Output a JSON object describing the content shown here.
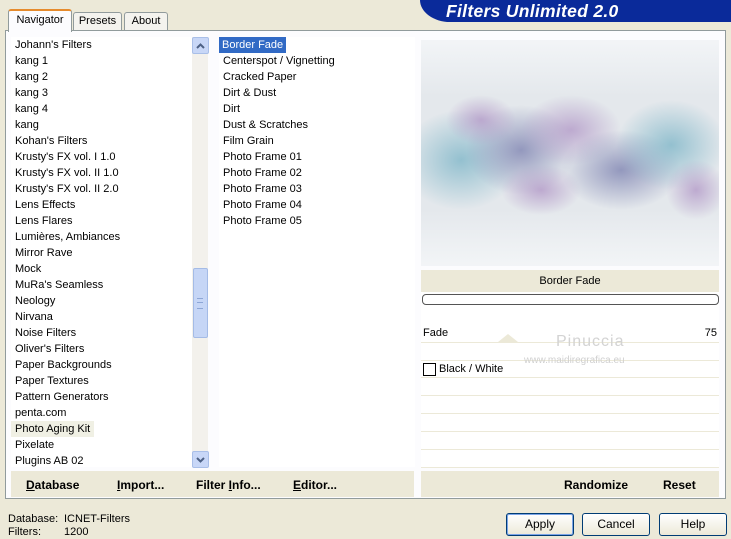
{
  "app": {
    "title": "Filters Unlimited 2.0"
  },
  "tabs": [
    {
      "label": "Navigator",
      "active": true
    },
    {
      "label": "Presets",
      "active": false
    },
    {
      "label": "About",
      "active": false
    }
  ],
  "categories": {
    "items": [
      "Johann's Filters",
      "kang 1",
      "kang 2",
      "kang 3",
      "kang 4",
      "kang",
      "Kohan's Filters",
      "Krusty's FX vol. I 1.0",
      "Krusty's FX vol. II 1.0",
      "Krusty's FX vol. II 2.0",
      "Lens Effects",
      "Lens Flares",
      "Lumières, Ambiances",
      "Mirror Rave",
      "Mock",
      "MuRa's Seamless",
      "Neology",
      "Nirvana",
      "Noise Filters",
      "Oliver's Filters",
      "Paper Backgrounds",
      "Paper Textures",
      "Pattern Generators",
      "penta.com",
      "Photo Aging Kit",
      "Pixelate",
      "Plugins AB 02"
    ],
    "selected": "Photo Aging Kit"
  },
  "filters": {
    "items": [
      "Border Fade",
      "Centerspot / Vignetting",
      "Cracked Paper",
      "Dirt & Dust",
      "Dirt",
      "Dust & Scratches",
      "Film Grain",
      "Photo Frame 01",
      "Photo Frame 02",
      "Photo Frame 03",
      "Photo Frame 04",
      "Photo Frame 05"
    ],
    "selected": "Border Fade"
  },
  "params": {
    "filter_name": "Border Fade",
    "fade_label": "Fade",
    "fade_value": "75",
    "bw_label": "Black / White",
    "bw_checked": false
  },
  "watermark": {
    "line1": "Pinuccia",
    "line2": "www.maidiregrafica.eu"
  },
  "toolbar": {
    "database": "Database",
    "import": "Import...",
    "filter_info": "Filter Info...",
    "editor": "Editor...",
    "randomize": "Randomize",
    "reset": "Reset"
  },
  "status": {
    "database_label": "Database:",
    "database_value": "ICNET-Filters",
    "filters_label": "Filters:",
    "filters_value": "1200"
  },
  "buttons": {
    "apply": "Apply",
    "cancel": "Cancel",
    "help": "Help"
  },
  "icons": {
    "scroll_up": "chevron-up-icon",
    "scroll_down": "chevron-down-icon"
  }
}
